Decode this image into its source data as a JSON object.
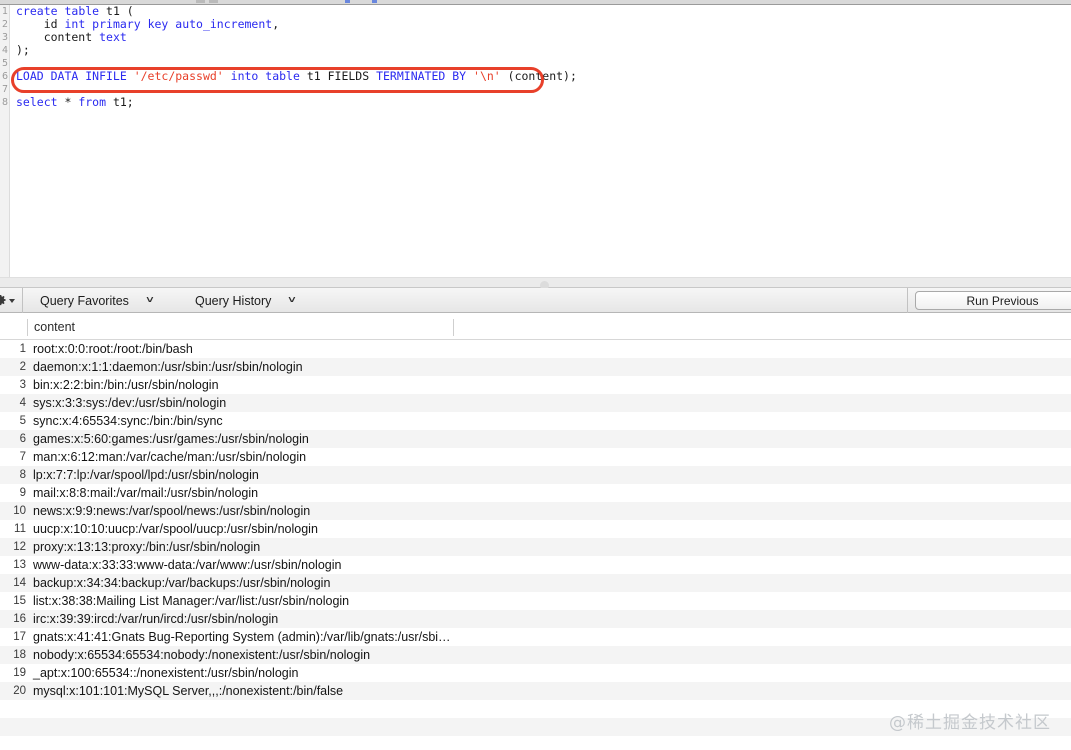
{
  "editor": {
    "lines": [
      {
        "num": "1",
        "tokens": [
          {
            "t": "create ",
            "c": "kw"
          },
          {
            "t": "table ",
            "c": "kw"
          },
          {
            "t": "t1 (",
            "c": "pl"
          }
        ]
      },
      {
        "num": "2",
        "tokens": [
          {
            "t": "    id ",
            "c": "pl"
          },
          {
            "t": "int ",
            "c": "kw"
          },
          {
            "t": "primary ",
            "c": "kw"
          },
          {
            "t": "key ",
            "c": "kw"
          },
          {
            "t": "auto_increment",
            "c": "kw"
          },
          {
            "t": ",",
            "c": "pl"
          }
        ]
      },
      {
        "num": "3",
        "tokens": [
          {
            "t": "    content ",
            "c": "pl"
          },
          {
            "t": "text",
            "c": "kw"
          }
        ]
      },
      {
        "num": "4",
        "tokens": [
          {
            "t": ");",
            "c": "pl"
          }
        ]
      },
      {
        "num": "5",
        "tokens": [
          {
            "t": "",
            "c": "pl"
          }
        ]
      },
      {
        "num": "6",
        "tokens": [
          {
            "t": "LOAD DATA INFILE ",
            "c": "kw"
          },
          {
            "t": "'/etc/passwd'",
            "c": "str"
          },
          {
            "t": " ",
            "c": "pl"
          },
          {
            "t": "into ",
            "c": "kw"
          },
          {
            "t": "table ",
            "c": "kw"
          },
          {
            "t": "t1 ",
            "c": "pl"
          },
          {
            "t": "FIELDS ",
            "c": "pl"
          },
          {
            "t": "TERMINATED ",
            "c": "kw"
          },
          {
            "t": "BY ",
            "c": "kw"
          },
          {
            "t": "'\\n'",
            "c": "str"
          },
          {
            "t": " (content);",
            "c": "pl"
          }
        ]
      },
      {
        "num": "7",
        "tokens": [
          {
            "t": "",
            "c": "pl"
          }
        ]
      },
      {
        "num": "8",
        "tokens": [
          {
            "t": "select ",
            "c": "kw"
          },
          {
            "t": "* ",
            "c": "pl"
          },
          {
            "t": "from ",
            "c": "kw"
          },
          {
            "t": "t1;",
            "c": "pl"
          }
        ]
      }
    ],
    "highlight_color": "#e8402a",
    "keyword_color": "#2a2af0",
    "string_color": "#e8402a"
  },
  "toolbar": {
    "gear_icon": "gear-icon",
    "query_favorites_label": "Query Favorites",
    "query_history_label": "Query History",
    "run_previous_label": "Run Previous",
    "chevron": "˅"
  },
  "results": {
    "columns": [
      "content"
    ],
    "rows": [
      {
        "n": "1",
        "content": "root:x:0:0:root:/root:/bin/bash"
      },
      {
        "n": "2",
        "content": "daemon:x:1:1:daemon:/usr/sbin:/usr/sbin/nologin"
      },
      {
        "n": "3",
        "content": "bin:x:2:2:bin:/bin:/usr/sbin/nologin"
      },
      {
        "n": "4",
        "content": "sys:x:3:3:sys:/dev:/usr/sbin/nologin"
      },
      {
        "n": "5",
        "content": "sync:x:4:65534:sync:/bin:/bin/sync"
      },
      {
        "n": "6",
        "content": "games:x:5:60:games:/usr/games:/usr/sbin/nologin"
      },
      {
        "n": "7",
        "content": "man:x:6:12:man:/var/cache/man:/usr/sbin/nologin"
      },
      {
        "n": "8",
        "content": "lp:x:7:7:lp:/var/spool/lpd:/usr/sbin/nologin"
      },
      {
        "n": "9",
        "content": "mail:x:8:8:mail:/var/mail:/usr/sbin/nologin"
      },
      {
        "n": "10",
        "content": "news:x:9:9:news:/var/spool/news:/usr/sbin/nologin"
      },
      {
        "n": "11",
        "content": "uucp:x:10:10:uucp:/var/spool/uucp:/usr/sbin/nologin"
      },
      {
        "n": "12",
        "content": "proxy:x:13:13:proxy:/bin:/usr/sbin/nologin"
      },
      {
        "n": "13",
        "content": "www-data:x:33:33:www-data:/var/www:/usr/sbin/nologin"
      },
      {
        "n": "14",
        "content": "backup:x:34:34:backup:/var/backups:/usr/sbin/nologin"
      },
      {
        "n": "15",
        "content": "list:x:38:38:Mailing List Manager:/var/list:/usr/sbin/nologin"
      },
      {
        "n": "16",
        "content": "irc:x:39:39:ircd:/var/run/ircd:/usr/sbin/nologin"
      },
      {
        "n": "17",
        "content": "gnats:x:41:41:Gnats Bug-Reporting System (admin):/var/lib/gnats:/usr/sbi…"
      },
      {
        "n": "18",
        "content": "nobody:x:65534:65534:nobody:/nonexistent:/usr/sbin/nologin"
      },
      {
        "n": "19",
        "content": "_apt:x:100:65534::/nonexistent:/usr/sbin/nologin"
      },
      {
        "n": "20",
        "content": "mysql:x:101:101:MySQL Server,,,:/nonexistent:/bin/false"
      }
    ]
  },
  "watermark": {
    "text": "@稀土掘金技术社区"
  }
}
